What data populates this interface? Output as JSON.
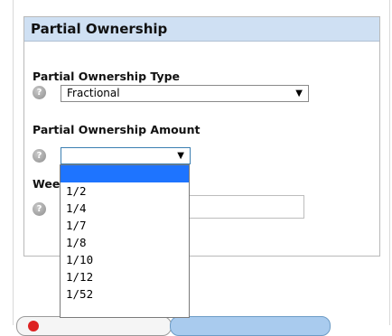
{
  "section": {
    "title": "Partial Ownership"
  },
  "fields": {
    "type_label": "Partial Ownership Type",
    "type_value": "Fractional",
    "amount_label": "Partial Ownership Amount",
    "amount_value": "",
    "weeks_label_partial": "Wee"
  },
  "dropdown": {
    "options": [
      "",
      "1/2",
      "1/4",
      "1/7",
      "1/8",
      "1/10",
      "1/12",
      "1/52"
    ],
    "selected_index": 0
  },
  "icons": {
    "help": "help-icon",
    "arrow": "chevron-down-icon"
  },
  "colors": {
    "header_bg": "#cfe0f3",
    "selection": "#1e74ff"
  }
}
